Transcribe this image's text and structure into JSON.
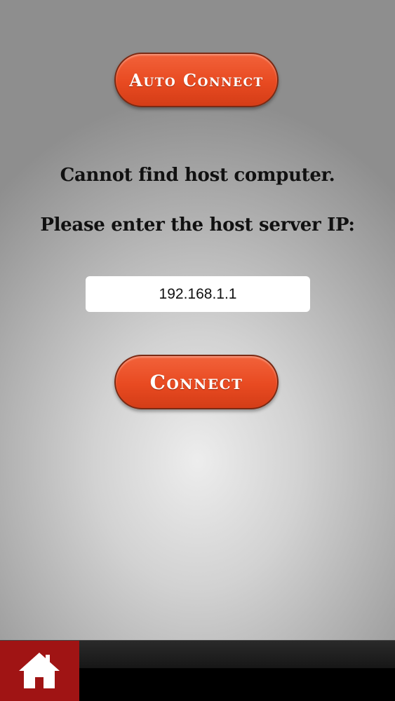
{
  "auto_connect": {
    "label": "Auto Connect"
  },
  "message": {
    "line1": "Cannot find host computer.",
    "line2": "Please enter the host server IP:"
  },
  "ip_field": {
    "value": "192.168.1.1"
  },
  "connect": {
    "label": "Connect"
  },
  "tab_bar": {
    "home_icon": "home-icon"
  },
  "colors": {
    "button_orange": "#e84a21",
    "home_tab_red": "#a01414",
    "tab_bar_black": "#000000"
  }
}
